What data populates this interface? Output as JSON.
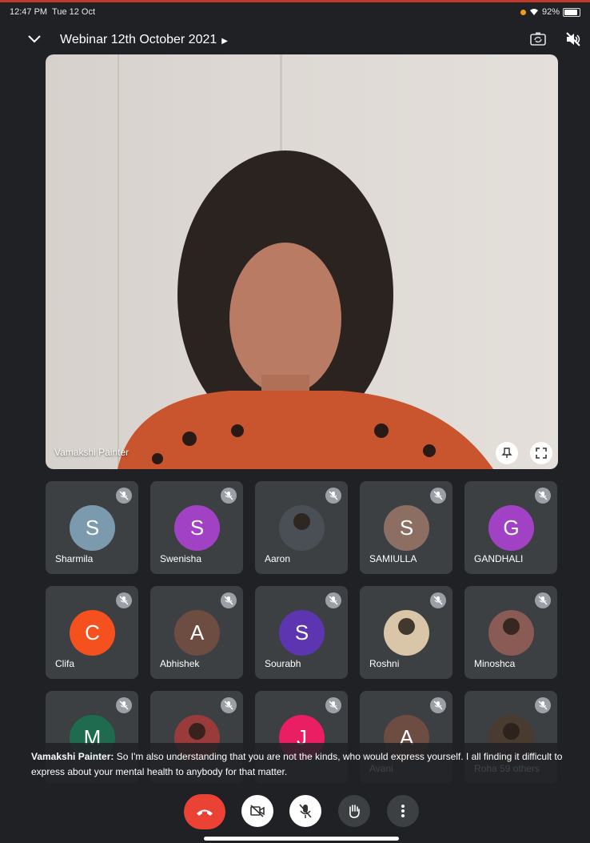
{
  "status_bar": {
    "time": "12:47 PM",
    "date": "Tue 12 Oct",
    "battery": "92%"
  },
  "header": {
    "meeting_title": "Webinar 12th October 2021"
  },
  "main_video": {
    "speaker_name": "Vamakshi Painter"
  },
  "participants": [
    {
      "name": "Sharmila",
      "initial": "S",
      "color": "#7b9aae"
    },
    {
      "name": "Swenisha",
      "initial": "S",
      "color": "#a142c4"
    },
    {
      "name": "Aaron",
      "initial": "",
      "color": "#4a4f55"
    },
    {
      "name": "SAMIULLA",
      "initial": "S",
      "color": "#8d6e63"
    },
    {
      "name": "GANDHALI",
      "initial": "G",
      "color": "#a142c4"
    },
    {
      "name": "Clifa",
      "initial": "C",
      "color": "#f4511e"
    },
    {
      "name": "Abhishek",
      "initial": "A",
      "color": "#6d4c41"
    },
    {
      "name": "Sourabh",
      "initial": "S",
      "color": "#5e35b1"
    },
    {
      "name": "Roshni",
      "initial": "",
      "color": "#d9c6a8"
    },
    {
      "name": "Minoshca",
      "initial": "",
      "color": "#8a5a55"
    },
    {
      "name": "",
      "initial": "M",
      "color": "#1e6b4f"
    },
    {
      "name": "",
      "initial": "",
      "color": "#9a3b3b"
    },
    {
      "name": "",
      "initial": "J",
      "color": "#e91e63"
    },
    {
      "name": "Avani",
      "initial": "A",
      "color": "#6d4c41"
    },
    {
      "name": "Roha  59 others",
      "initial": "",
      "color": "#4a3b30"
    }
  ],
  "caption": {
    "speaker": "Vamakshi Painter:",
    "text": " So I'm also understanding that you are not the kinds, who would express yourself. I all finding it difficult to express about your mental health to anybody for that matter."
  },
  "colors": {
    "end_call": "#ea4335",
    "background": "#202124",
    "tile": "#3c4043"
  }
}
